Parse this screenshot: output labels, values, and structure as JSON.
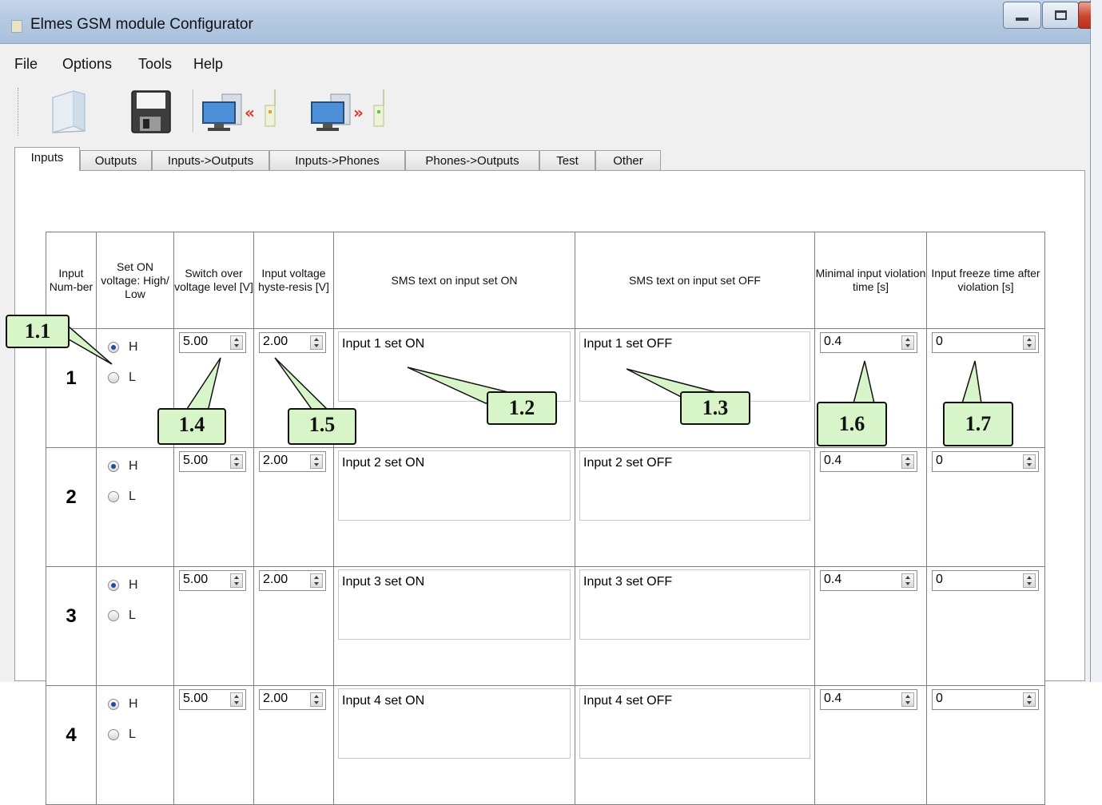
{
  "window": {
    "title": "Elmes GSM module Configurator",
    "buttons": {
      "minimize": "—",
      "maximize": "□",
      "close": "X"
    }
  },
  "menu": [
    "File",
    "Options",
    "Tools",
    "Help"
  ],
  "toolbar": {
    "icons": [
      "open-file-icon",
      "save-disk-icon",
      "read-from-module-icon",
      "write-to-module-icon"
    ]
  },
  "tabs": [
    "Inputs",
    "Outputs",
    "Inputs->Outputs",
    "Inputs->Phones",
    "Phones->Outputs",
    "Test",
    "Other"
  ],
  "active_tab": "Inputs",
  "table": {
    "headers": {
      "num": "Input Num-ber",
      "voltage": "Set ON voltage: High/ Low",
      "switch": "Switch over voltage level [V]",
      "hyst": "Input voltage hyste-resis [V]",
      "sms_on": "SMS text on input set ON",
      "sms_off": "SMS text on input set OFF",
      "min_time": "Minimal input violation time [s]",
      "freeze": "Input freeze time after violation [s]"
    },
    "radio_labels": {
      "high": "H",
      "low": "L"
    },
    "rows": [
      {
        "num": "1",
        "sel": "H",
        "switch": "5.00",
        "hyst": "2.00",
        "sms_on": "Input 1 set ON",
        "sms_off": "Input 1 set OFF",
        "min_time": "0.4",
        "freeze": "0"
      },
      {
        "num": "2",
        "sel": "H",
        "switch": "5.00",
        "hyst": "2.00",
        "sms_on": "Input 2 set ON",
        "sms_off": "Input 2 set OFF",
        "min_time": "0.4",
        "freeze": "0"
      },
      {
        "num": "3",
        "sel": "H",
        "switch": "5.00",
        "hyst": "2.00",
        "sms_on": "Input 3 set ON",
        "sms_off": "Input 3 set OFF",
        "min_time": "0.4",
        "freeze": "0"
      },
      {
        "num": "4",
        "sel": "H",
        "switch": "5.00",
        "hyst": "2.00",
        "sms_on": "Input 4 set ON",
        "sms_off": "Input 4 set OFF",
        "min_time": "0.4",
        "freeze": "0"
      }
    ]
  },
  "callouts": [
    "1.1",
    "1.2",
    "1.3",
    "1.4",
    "1.5",
    "1.6",
    "1.7"
  ],
  "colors": {
    "callout_fill": "#d8f5c9",
    "radio_dot": "#1e4e9c",
    "titlebar": "#b6cbe3"
  }
}
